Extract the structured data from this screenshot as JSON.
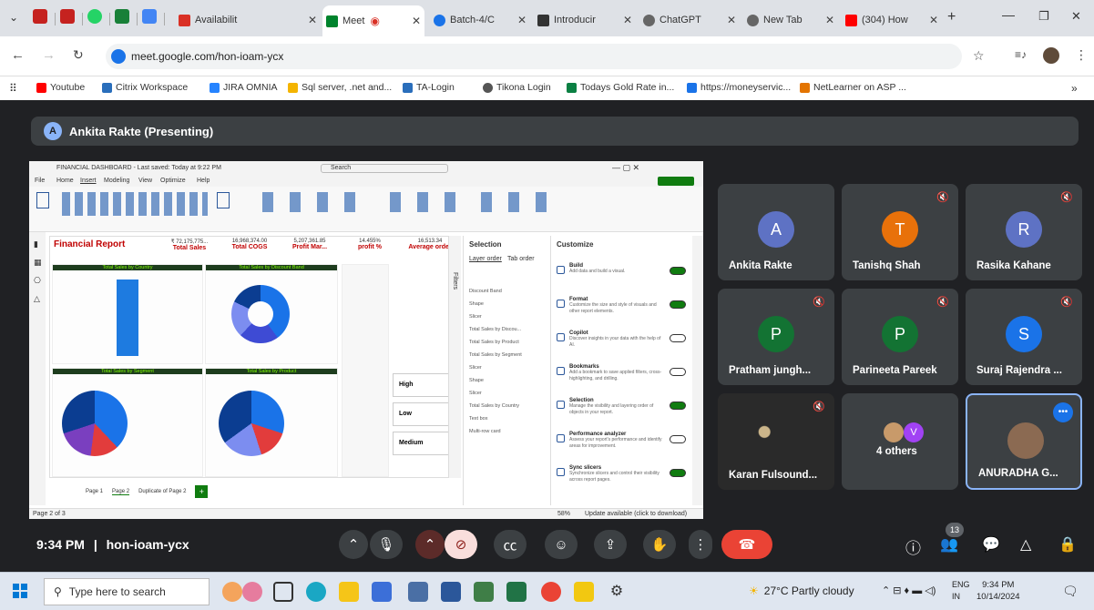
{
  "browser": {
    "tabs": [
      {
        "title": "Availabilit",
        "color": "#d93025",
        "icon": "gmail-icon"
      },
      {
        "title": "Meet",
        "color": "#00832d",
        "icon": "meet-icon",
        "active": true
      },
      {
        "title": "Batch-4/C",
        "color": "#1a73e8",
        "icon": "batch-icon"
      },
      {
        "title": "Introducir",
        "color": "#333333",
        "icon": "intro-icon"
      },
      {
        "title": "ChatGPT",
        "color": "#555555",
        "icon": "chatgpt-icon"
      },
      {
        "title": "New Tab",
        "color": "#555555",
        "icon": "newtab-icon"
      },
      {
        "title": "(304) How",
        "color": "#ff0000",
        "icon": "youtube-icon"
      }
    ],
    "url": "meet.google.com/hon-ioam-ycx",
    "bookmarks": [
      "Youtube",
      "Citrix Workspace",
      "JIRA OMNIA",
      "Sql server, .net and...",
      "TA-Login",
      "Tikona Login",
      "Todays Gold Rate in...",
      "https://moneyservic...",
      "NetLearner on ASP ..."
    ]
  },
  "meet": {
    "presenting_label": "Ankita Rakte (Presenting)",
    "presenter_initial": "A",
    "time": "9:34 PM",
    "meeting_code": "hon-ioam-ycx",
    "participant_count": "13",
    "participants": [
      {
        "name": "Ankita Rakte",
        "initial": "A",
        "color": "#5e72c4",
        "muted": false
      },
      {
        "name": "Tanishq Shah",
        "initial": "T",
        "color": "#e8710a",
        "muted": true
      },
      {
        "name": "Rasika Kahane",
        "initial": "R",
        "color": "#5e72c4",
        "muted": true
      },
      {
        "name": "Pratham jungh...",
        "initial": "P",
        "color": "#137333",
        "muted": true
      },
      {
        "name": "Parineeta Pareek",
        "initial": "P",
        "color": "#137333",
        "muted": true
      },
      {
        "name": "Suraj Rajendra ...",
        "initial": "S",
        "color": "#1a73e8",
        "muted": true
      },
      {
        "name": "Karan Fulsound...",
        "initial": "",
        "color": "#333333",
        "muted": true
      },
      {
        "name": "4 others",
        "initial": "V",
        "color": "#a142f4",
        "muted": false
      },
      {
        "name": "ANURADHA G...",
        "initial": "",
        "color": "#6b4d3a",
        "muted": false
      }
    ]
  },
  "shared_screen": {
    "title": "FINANCIAL DASHBOARD - Last saved: Today at 9:22 PM",
    "search": "Search",
    "menu": [
      "File",
      "Home",
      "Insert",
      "Modeling",
      "View",
      "Optimize",
      "Help"
    ],
    "report_title": "Financial Report",
    "kpis": [
      {
        "value": "₹ 72,175,775...",
        "label": "Total Sales"
      },
      {
        "value": "16,968,374.00",
        "label": "Total COGS"
      },
      {
        "value": "5,207,361.85",
        "label": "Profit Mar..."
      },
      {
        "value": "14.455%",
        "label": "profit %"
      },
      {
        "value": "16,513.34",
        "label": "Average order"
      }
    ],
    "charts": [
      "Total Sales by Country",
      "Total Sales by Discount Band",
      "Total Sales by Segment",
      "Total Sales by Product"
    ],
    "slicer_items": [
      "High",
      "Low",
      "Medium"
    ],
    "selection_title": "Selection",
    "selection_tabs": [
      "Layer order",
      "Tab order"
    ],
    "selection_items": [
      "Discount Band",
      "Shape",
      "Slicer",
      "Total Sales by Discou...",
      "Total Sales by Product",
      "Total Sales by Segment",
      "Slicer",
      "Shape",
      "Slicer",
      "Total Sales by Country",
      "Text box",
      "Multi-row card"
    ],
    "customize_title": "Customize",
    "customize_items": [
      {
        "name": "Build",
        "desc": "Add data and build a visual.",
        "on": true
      },
      {
        "name": "Format",
        "desc": "Customize the size and style of visuals and other report elements.",
        "on": true
      },
      {
        "name": "Copilot",
        "desc": "Discover insights in your data with the help of AI.",
        "on": false
      },
      {
        "name": "Bookmarks",
        "desc": "Add a bookmark to save applied filters, cross-highlighting, and drilling.",
        "on": false
      },
      {
        "name": "Selection",
        "desc": "Manage the visibility and layering order of objects in your report.",
        "on": true
      },
      {
        "name": "Performance analyzer",
        "desc": "Assess your report's performance and identify areas for improvement.",
        "on": false
      },
      {
        "name": "Sync slicers",
        "desc": "Synchronize slicers and control their visibility across report pages.",
        "on": true
      }
    ],
    "pages": [
      "Page 1",
      "Page 2",
      "Duplicate of Page 2"
    ],
    "status_left": "Page 2 of 3",
    "status_right": "Update available (click to download)",
    "filters": "Filters",
    "zoom": "58%"
  },
  "taskbar": {
    "search_placeholder": "Type here to search",
    "weather": "27°C Partly cloudy",
    "lang": "ENG",
    "region": "IN",
    "time": "9:34 PM",
    "date": "10/14/2024"
  }
}
